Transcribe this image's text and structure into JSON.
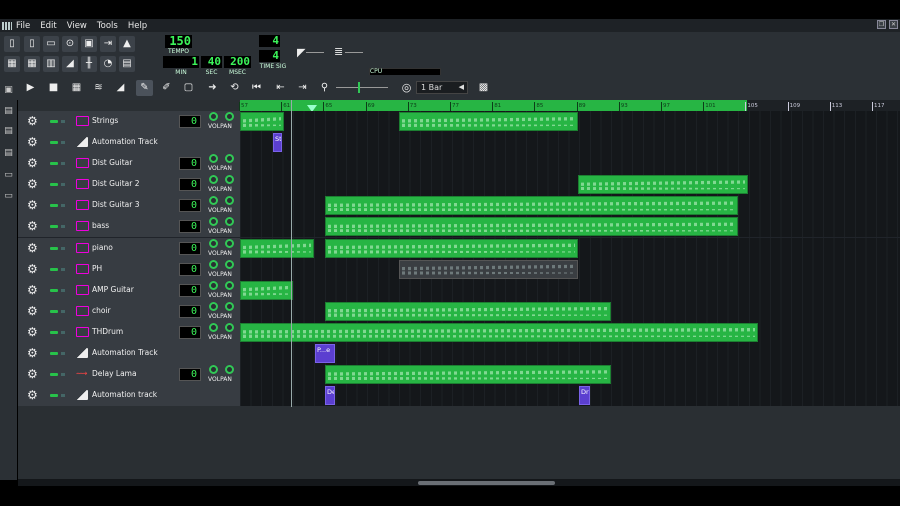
{
  "menu": [
    "File",
    "Edit",
    "View",
    "Tools",
    "Help"
  ],
  "transport": {
    "tempo": "150",
    "tempo_label": "TEMPO",
    "min": "1",
    "min_label": "MIN",
    "sec": "40",
    "sec_label": "SEC",
    "msec": "200",
    "msec_label": "MSEC",
    "timesig_top": "4",
    "timesig_bottom": "4",
    "timesig_label": "TIME SIG",
    "cpu_label": "CPU"
  },
  "zoom": {
    "value": "1 Bar"
  },
  "timeline": {
    "ticks": [
      "57",
      "61",
      "65",
      "69",
      "73",
      "77",
      "81",
      "85",
      "89",
      "93",
      "97",
      "101",
      "105",
      "109",
      "113",
      "117"
    ]
  },
  "tracks": [
    {
      "name": "Strings",
      "vol": "0",
      "type": "inst",
      "knob_label": "VOLPAN"
    },
    {
      "name": "Automation Track",
      "type": "auto"
    },
    {
      "name": "Dist Guitar",
      "vol": "0",
      "type": "inst",
      "knob_label": "VOLPAN"
    },
    {
      "name": "Dist Guitar 2",
      "vol": "0",
      "type": "inst",
      "knob_label": "VOLPAN"
    },
    {
      "name": "Dist Guitar 3",
      "vol": "0",
      "type": "inst",
      "knob_label": "VOLPAN"
    },
    {
      "name": "bass",
      "vol": "0",
      "type": "inst",
      "knob_label": "VOLPAN"
    },
    {
      "name": "piano",
      "vol": "0",
      "type": "inst",
      "knob_label": "VOLPAN"
    },
    {
      "name": "PH",
      "vol": "0",
      "type": "inst",
      "knob_label": "VOLPAN"
    },
    {
      "name": "AMP Guitar",
      "vol": "0",
      "type": "inst",
      "knob_label": "VOLPAN"
    },
    {
      "name": "choir",
      "vol": "0",
      "type": "inst",
      "knob_label": "VOLPAN"
    },
    {
      "name": "THDrum",
      "vol": "0",
      "type": "inst",
      "knob_label": "VOLPAN"
    },
    {
      "name": "Automation Track",
      "type": "auto"
    },
    {
      "name": "Delay Lama",
      "vol": "0",
      "type": "fx",
      "knob_label": "VOLPAN"
    },
    {
      "name": "Automation track",
      "type": "auto"
    }
  ],
  "clip_labels": {
    "st": "St",
    "pe": "P...e",
    "de": "De",
    "dr": "Dr"
  },
  "colors": {
    "accent": "#27b544",
    "lcd": "#3cf55a",
    "automation": "#5b3fd0"
  }
}
